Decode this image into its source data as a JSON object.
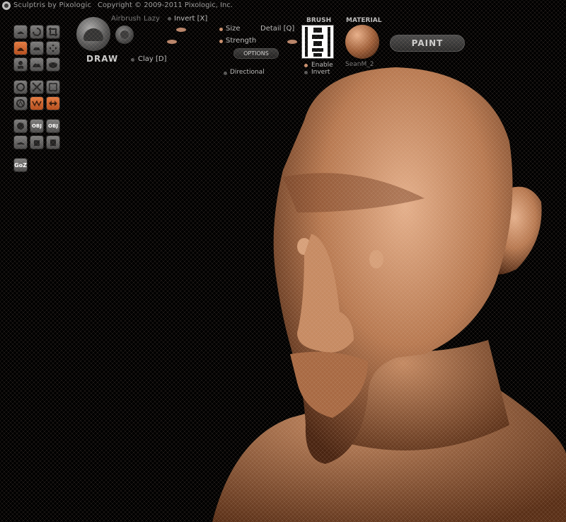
{
  "title": {
    "app": "Sculptris by Pixologic",
    "copyright": "Copyright © 2009-2011 Pixologic, Inc."
  },
  "brush": {
    "mode_label": "DRAW",
    "airbrush": "Airbrush",
    "lazy": "Lazy",
    "invert": "Invert [X]",
    "clay": "Clay [D]",
    "size": "Size",
    "strength": "Strength",
    "detail": "Detail [Q]",
    "options": "OPTIONS",
    "directional": "Directional"
  },
  "brush_panel": {
    "header": "BRUSH",
    "enable": "Enable",
    "invert": "Invert"
  },
  "material_panel": {
    "header": "MATERIAL",
    "name": "SeanM_2"
  },
  "paint_button": "PAINT",
  "toolbar": {
    "goz": "GoZ",
    "save_obj": "OBJ",
    "open_obj": "OBJ"
  },
  "colors": {
    "accent": "#d66a30",
    "skin": "#b87a52",
    "bg": "#000000"
  }
}
